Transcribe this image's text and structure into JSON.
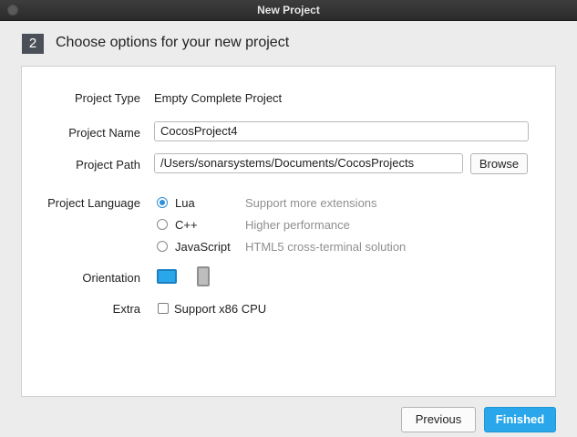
{
  "window": {
    "title": "New Project"
  },
  "header": {
    "step": "2",
    "title": "Choose options for your new project"
  },
  "form": {
    "project_type": {
      "label": "Project Type",
      "value": "Empty Complete Project"
    },
    "project_name": {
      "label": "Project Name",
      "value": "CocosProject4"
    },
    "project_path": {
      "label": "Project Path",
      "value": "/Users/sonarsystems/Documents/CocosProjects",
      "browse_label": "Browse"
    },
    "language": {
      "label": "Project Language",
      "selected": "Lua",
      "options": [
        {
          "label": "Lua",
          "hint": "Support more extensions"
        },
        {
          "label": "C++",
          "hint": "Higher performance"
        },
        {
          "label": "JavaScript",
          "hint": "HTML5 cross-terminal solution"
        }
      ]
    },
    "orientation": {
      "label": "Orientation",
      "selected": "landscape",
      "options": [
        "landscape-icon",
        "portrait-icon"
      ]
    },
    "extra": {
      "label": "Extra",
      "checkbox_label": "Support x86 CPU",
      "checked": false
    }
  },
  "footer": {
    "previous_label": "Previous",
    "finished_label": "Finished"
  },
  "colors": {
    "accent": "#29a7ea",
    "titlebar": "#2f2f2f",
    "step_badge": "#4b4f57"
  }
}
